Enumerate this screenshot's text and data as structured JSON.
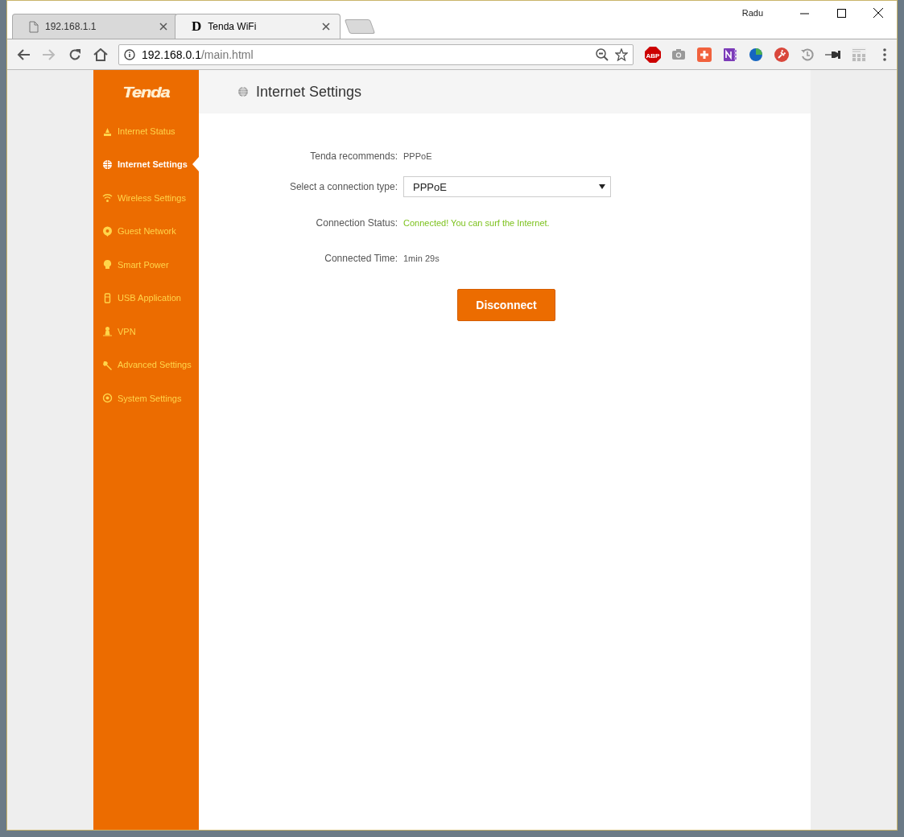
{
  "browser": {
    "profile_name": "Radu",
    "tabs": [
      {
        "title": "192.168.1.1",
        "selected": false
      },
      {
        "title": "Tenda WiFi",
        "selected": true,
        "favicon_text": "D"
      }
    ],
    "address": {
      "host": "192.168.0.1",
      "path": "/main.html"
    },
    "adblock_label": "ABP"
  },
  "sidebar": {
    "logo": "Tenda",
    "items": [
      {
        "label": "Internet Status",
        "selected": false
      },
      {
        "label": "Internet Settings",
        "selected": true
      },
      {
        "label": "Wireless Settings",
        "selected": false
      },
      {
        "label": "Guest Network",
        "selected": false
      },
      {
        "label": "Smart Power",
        "selected": false
      },
      {
        "label": "USB Application",
        "selected": false
      },
      {
        "label": "VPN",
        "selected": false
      },
      {
        "label": "Advanced Settings",
        "selected": false
      },
      {
        "label": "System Settings",
        "selected": false
      }
    ]
  },
  "page": {
    "title": "Internet Settings",
    "fields": [
      {
        "kind": "text",
        "label": "Tenda recommends:",
        "value": "PPPoE"
      },
      {
        "kind": "select",
        "label": "Select a connection type:",
        "value": "PPPoE"
      },
      {
        "kind": "status",
        "label": "Connection Status:",
        "value": "Connected! You can surf the Internet."
      },
      {
        "kind": "text",
        "label": "Connected Time:",
        "value": "1min 29s"
      }
    ],
    "button": "Disconnect"
  }
}
